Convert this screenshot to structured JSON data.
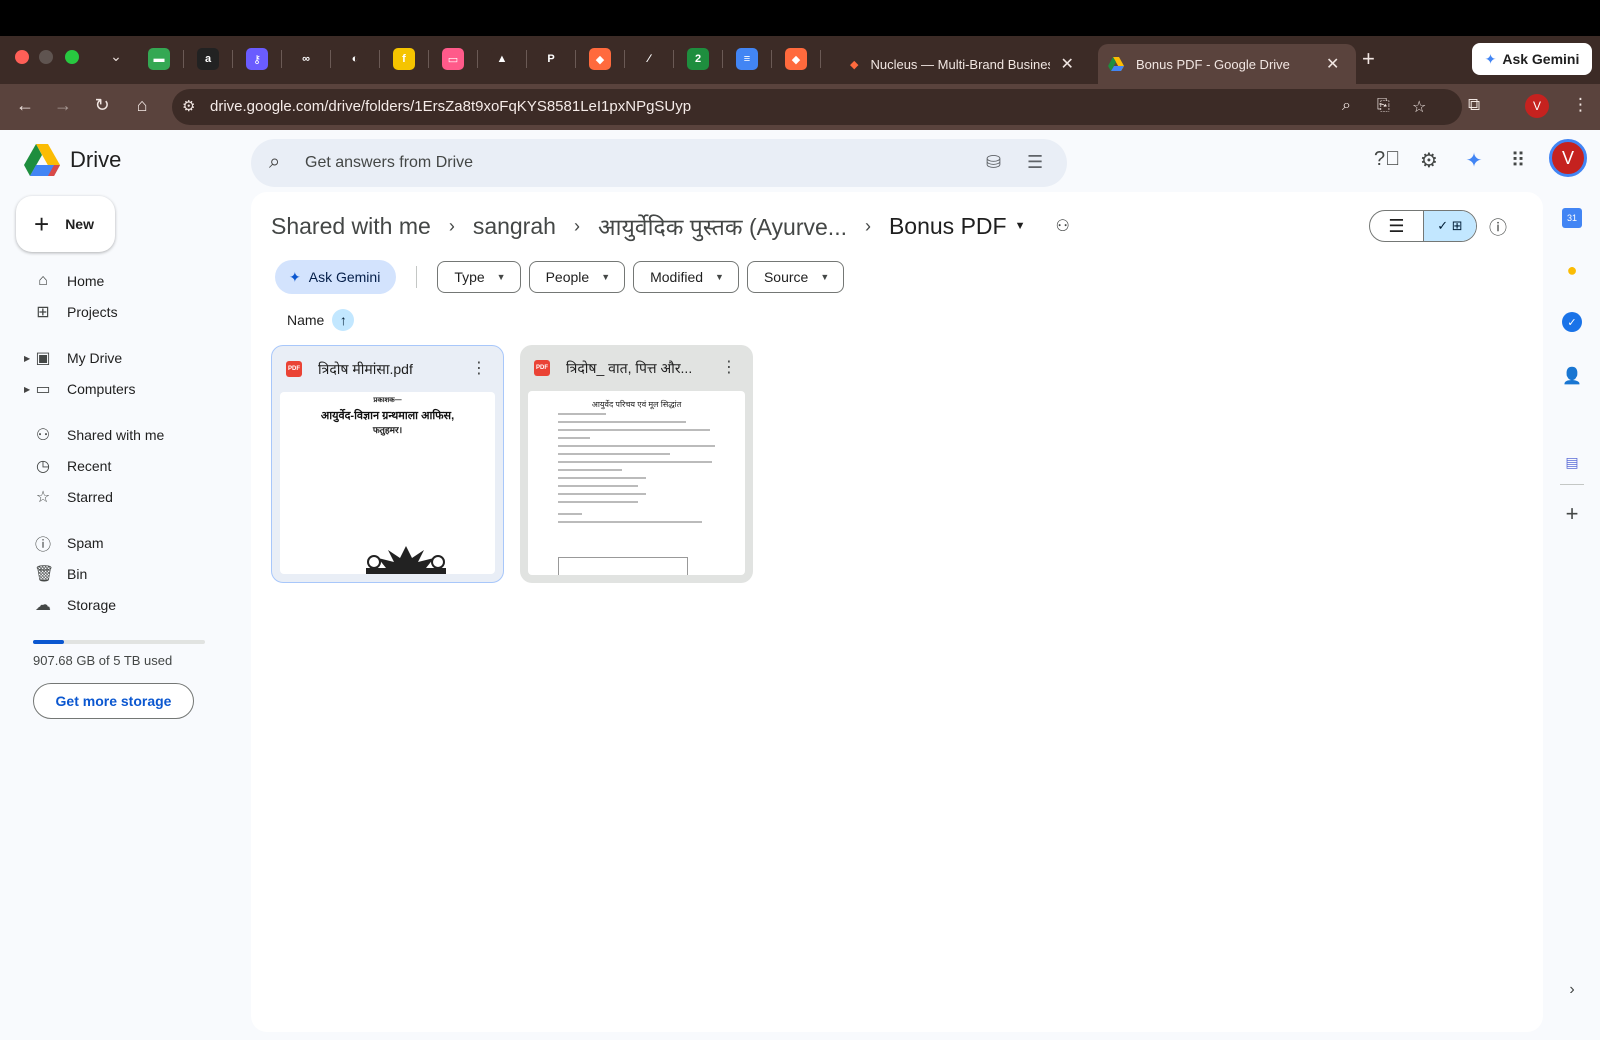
{
  "browser": {
    "pinned_tabs": [
      {
        "icon": "spreadsheet-icon",
        "color": "#34a853",
        "glyph": "▬"
      },
      {
        "icon": "amazon-icon",
        "color": "#222222",
        "glyph": "a"
      },
      {
        "icon": "key-icon",
        "color": "#6a5cff",
        "glyph": "⚷"
      },
      {
        "icon": "meta-icon",
        "color": "#3c2b26",
        "glyph": "∞"
      },
      {
        "icon": "nucleus-icon",
        "color": "#3c2b26",
        "glyph": "◐"
      },
      {
        "icon": "flipkart-icon",
        "color": "#f5c400",
        "glyph": "f"
      },
      {
        "icon": "pink-app-icon",
        "color": "#ff5a8a",
        "glyph": "▭"
      },
      {
        "icon": "drive-icon",
        "color": "#3c2b26",
        "glyph": "▲"
      },
      {
        "icon": "paypal-icon",
        "color": "#3c2b26",
        "glyph": "P"
      },
      {
        "icon": "gradient-app-icon",
        "color": "#ff6a3d",
        "glyph": "◆"
      },
      {
        "icon": "arrow-app-icon",
        "color": "#3c2b26",
        "glyph": "∕"
      },
      {
        "icon": "badge-2-icon",
        "color": "#1e8e3e",
        "glyph": "2"
      },
      {
        "icon": "docs-icon",
        "color": "#4285f4",
        "glyph": "≡"
      },
      {
        "icon": "gradient-app-2-icon",
        "color": "#ff6a3d",
        "glyph": "◆"
      }
    ],
    "tabs": [
      {
        "label": "Nucleus — Multi-Brand Business",
        "active": false
      },
      {
        "label": "Bonus PDF - Google Drive",
        "active": true
      }
    ],
    "ask_gemini": "Ask Gemini",
    "url": "drive.google.com/drive/folders/1ErsZa8t9xoFqKYS8581LeI1pxNPgSUyp",
    "profile_initial": "V"
  },
  "drive": {
    "app_name": "Drive",
    "search_placeholder": "Get answers from Drive",
    "avatar_initial": "V",
    "new_label": "New",
    "nav": [
      {
        "label": "Home",
        "icon": "home-icon",
        "glyph": "⌂",
        "caret": false
      },
      {
        "label": "Projects",
        "icon": "projects-icon",
        "glyph": "⊞",
        "caret": false
      },
      {
        "label": "My Drive",
        "icon": "my-drive-icon",
        "glyph": "▣",
        "caret": true
      },
      {
        "label": "Computers",
        "icon": "computers-icon",
        "glyph": "▭",
        "caret": true
      },
      {
        "label": "Shared with me",
        "icon": "shared-icon",
        "glyph": "⚇",
        "caret": false
      },
      {
        "label": "Recent",
        "icon": "clock-icon",
        "glyph": "◷",
        "caret": false
      },
      {
        "label": "Starred",
        "icon": "star-icon",
        "glyph": "☆",
        "caret": false
      },
      {
        "label": "Spam",
        "icon": "spam-icon",
        "glyph": "ⓘ",
        "caret": false
      },
      {
        "label": "Bin",
        "icon": "bin-icon",
        "glyph": "🗑",
        "caret": false
      },
      {
        "label": "Storage",
        "icon": "cloud-icon",
        "glyph": "☁",
        "caret": false
      }
    ],
    "storage": {
      "used_text": "907.68 GB of 5 TB used",
      "fraction": 0.18,
      "button": "Get more storage"
    },
    "breadcrumbs": [
      "Shared with me",
      "sangrah",
      "आयुर्वेदिक पुस्तक (Ayurve..."
    ],
    "current_folder": "Bonus PDF",
    "ask_gemini_chip": "Ask Gemini",
    "filters": [
      "Type",
      "People",
      "Modified",
      "Source"
    ],
    "sort_label": "Name",
    "files": [
      {
        "name": "त्रिदोष मीमांसा.pdf",
        "type_badge": "PDF",
        "selected": true,
        "thumb_lines": [
          "प्रकाशक—",
          "आयुर्वेद-विज्ञान ग्रन्थमाला आफिस,",
          "फतुहमर।"
        ]
      },
      {
        "name": "त्रिदोष_ वात, पित्त और...",
        "type_badge": "PDF",
        "selected": false,
        "thumb_title": "आयुर्वेद परिचय एवं मूल सिद्धांत"
      }
    ],
    "colors": {
      "accent": "#0b57d0",
      "chip_bg": "#d3e3fd",
      "selected_toggle": "#c2e7ff",
      "pdf_red": "#ea4335"
    }
  }
}
